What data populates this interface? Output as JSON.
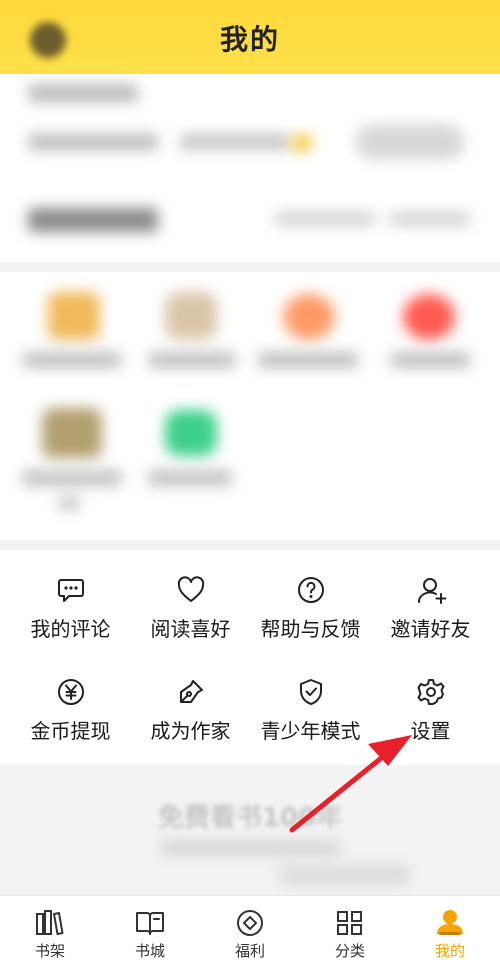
{
  "header": {
    "title": "我的"
  },
  "menu": [
    {
      "label": "我的评论",
      "icon": "comment-icon"
    },
    {
      "label": "阅读喜好",
      "icon": "heart-icon"
    },
    {
      "label": "帮助与反馈",
      "icon": "help-icon"
    },
    {
      "label": "邀请好友",
      "icon": "add-user-icon"
    },
    {
      "label": "金币提现",
      "icon": "yuan-coin-icon"
    },
    {
      "label": "成为作家",
      "icon": "pen-icon"
    },
    {
      "label": "青少年模式",
      "icon": "shield-check-icon"
    },
    {
      "label": "设置",
      "icon": "gear-icon"
    }
  ],
  "promo": {
    "text": "免费看书100年"
  },
  "tabs": [
    {
      "label": "书架",
      "icon": "bookshelf-icon"
    },
    {
      "label": "书城",
      "icon": "book-icon"
    },
    {
      "label": "福利",
      "icon": "welfare-icon"
    },
    {
      "label": "分类",
      "icon": "category-icon"
    },
    {
      "label": "我的",
      "icon": "profile-icon",
      "active": true
    }
  ],
  "colors": {
    "accent": "#f5a300",
    "header": "#ffd93a",
    "arrow": "#e8202a"
  }
}
